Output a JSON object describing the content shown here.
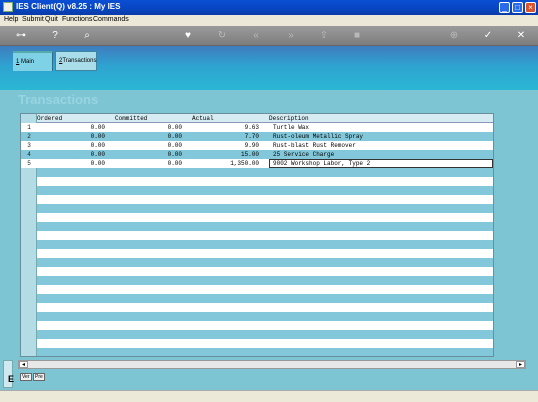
{
  "window": {
    "title": "IES Client(Q) v8.25 : My IES"
  },
  "menu": [
    "Help",
    "Submit",
    "Quit",
    "Functions",
    "Commands"
  ],
  "toolbar": {
    "icons": [
      "key-icon",
      "help-icon",
      "search-icon",
      "heart-icon",
      "refresh-icon",
      "rewind-icon",
      "fast-forward-icon",
      "upload-icon",
      "stop-icon",
      "add-icon",
      "check-icon",
      "close-icon"
    ]
  },
  "tabs": [
    {
      "number": "1",
      "label": "Main"
    },
    {
      "number": "2",
      "label": "Transactions"
    }
  ],
  "section": {
    "title": "Transactions"
  },
  "grid": {
    "columns": [
      "Ordered",
      "Committed",
      "Actual",
      "Description"
    ],
    "rows": [
      {
        "n": "1",
        "ordered": "0.00",
        "committed": "0.00",
        "actual": "9.63",
        "description": "Turtle Wax"
      },
      {
        "n": "2",
        "ordered": "0.00",
        "committed": "0.00",
        "actual": "7.70",
        "description": "Rust-oleum Metallic Spray"
      },
      {
        "n": "3",
        "ordered": "0.00",
        "committed": "0.00",
        "actual": "9.90",
        "description": "Rust-blast Rust Remover"
      },
      {
        "n": "4",
        "ordered": "0.00",
        "committed": "0.00",
        "actual": "15.00",
        "description": "25 Service Charge"
      },
      {
        "n": "5",
        "ordered": "0.00",
        "committed": "0.00",
        "actual": "1,350.00",
        "description": "9002 Workshop Labor, Type 2"
      }
    ]
  },
  "bottom_tabs": [
    "Ver",
    "Pre"
  ],
  "side_label": "E"
}
